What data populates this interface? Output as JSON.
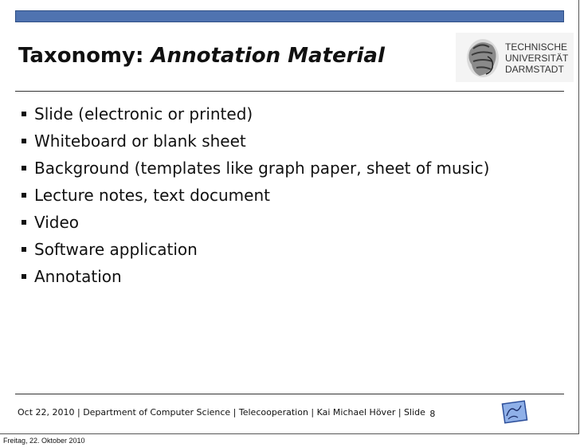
{
  "slide": {
    "title_prefix": "Taxonomy: ",
    "title_italic": "Annotation Material",
    "logo_lines": [
      "TECHNISCHE",
      "UNIVERSITÄT",
      "DARMSTADT"
    ],
    "bullets": [
      "Slide (electronic or printed)",
      "Whiteboard or blank sheet",
      "Background (templates like graph paper, sheet of music)",
      "Lecture notes, text document",
      "Video",
      "Software application",
      "Annotation"
    ],
    "footer": {
      "text": "Oct 22, 2010 | Department of Computer Science  |  Telecooperation  |  Kai Michael Höver | Slide",
      "page": "8"
    },
    "colors": {
      "topbar": "#4f73b0"
    }
  },
  "date_stamp": "Freitag, 22. Oktober 2010"
}
